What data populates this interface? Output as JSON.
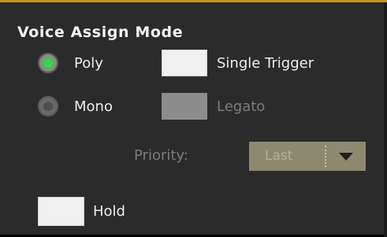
{
  "section_title": "Voice Assign Mode",
  "mode_options": [
    {
      "label": "Poly",
      "selected": true
    },
    {
      "label": "Mono",
      "selected": false
    }
  ],
  "single_trigger": {
    "label": "Single Trigger",
    "checked": false,
    "enabled": true
  },
  "legato": {
    "label": "Legato",
    "checked": false,
    "enabled": false
  },
  "priority": {
    "label": "Priority:",
    "value": "Last",
    "enabled": false
  },
  "hold": {
    "label": "Hold",
    "checked": false,
    "enabled": true
  },
  "colors": {
    "accent_top_border": "#c7941f",
    "radio_selected": "#34d84b",
    "panel_background": "#2b2b2b",
    "dropdown_disabled": "#8d896e"
  },
  "icons": {
    "dropdown_arrow": "triangle-down"
  }
}
